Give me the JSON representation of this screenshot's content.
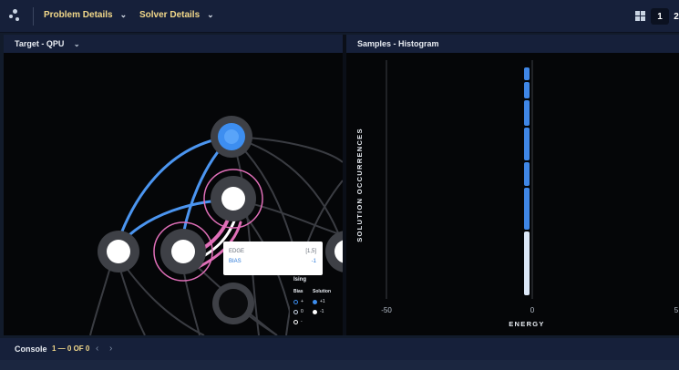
{
  "header": {
    "menus": [
      {
        "label": "Problem Details"
      },
      {
        "label": "Solver Details"
      }
    ],
    "pagination": {
      "current": "1",
      "next": "2"
    }
  },
  "left_panel": {
    "title": "Target - QPU",
    "tooltip": {
      "edge_label": "EDGE",
      "edge_value": "[1,5]",
      "bias_label": "BIAS",
      "bias_value": "-1"
    },
    "legend": {
      "title": "Ising",
      "bias_header": "Bias",
      "solution_header": "Solution",
      "bias_items": [
        "+",
        "0",
        "-"
      ],
      "solution_items": [
        "+1",
        "-1"
      ]
    }
  },
  "right_panel": {
    "title": "Samples - Histogram",
    "chart_data": {
      "type": "bar",
      "ylabel": "SOLUTION OCCURRENCES",
      "xlabel": "ENERGY",
      "x_ticks": [
        "-50",
        "0",
        "5"
      ],
      "bar_energy": 0
    }
  },
  "console": {
    "label": "Console",
    "count": "1 — 0 OF 0"
  },
  "colors": {
    "accent_yellow": "#f3d98a",
    "node_blue": "#3d8ef0",
    "edge_pink": "#e06fb8",
    "bar_blue": "#3f86e6",
    "bar_light": "#dce8f8"
  }
}
